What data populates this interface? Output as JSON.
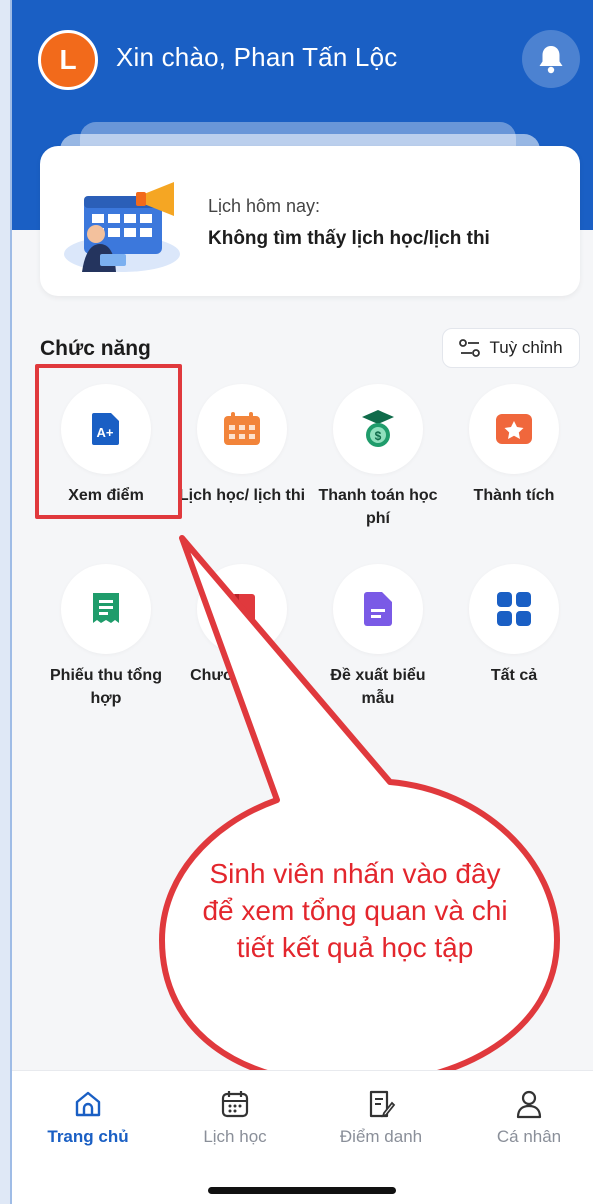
{
  "header": {
    "avatar_letter": "L",
    "greeting": "Xin chào, Phan Tấn Lộc",
    "bell_icon": "bell-icon"
  },
  "schedule": {
    "label": "Lịch hôm nay:",
    "value": "Không tìm thấy lịch học/lịch thi"
  },
  "functions": {
    "title": "Chức năng",
    "customize_label": "Tuỳ chỉnh",
    "items": [
      {
        "label": "Xem điểm",
        "icon": "grade-a-plus-icon",
        "color": "#1a5fc4"
      },
      {
        "label": "Lịch học/ lịch thi",
        "icon": "calendar-grid-icon",
        "color": "#f2843a"
      },
      {
        "label": "Thanh toán học phí",
        "icon": "tuition-coin-icon",
        "color": "#1f9c6b"
      },
      {
        "label": "Thành tích",
        "icon": "achievement-star-icon",
        "color": "#f0673c"
      },
      {
        "label": "Phiếu thu tổng hợp",
        "icon": "receipt-icon",
        "color": "#1f9c6b"
      },
      {
        "label": "Chươ... khu...",
        "icon": "program-book-icon",
        "color": "#e0393d"
      },
      {
        "label": "Đề xuất biểu mẫu",
        "icon": "form-document-icon",
        "color": "#7a5ae6"
      },
      {
        "label": "Tất cả",
        "icon": "all-apps-icon",
        "color": "#1a5fc4"
      }
    ]
  },
  "callout": {
    "text": "Sinh viên nhấn vào đây để xem tổng quan và chi tiết kết quả học tập",
    "color": "#e0393d"
  },
  "bottom_nav": {
    "items": [
      {
        "label": "Trang chủ",
        "icon": "home-icon",
        "active": true
      },
      {
        "label": "Lịch học",
        "icon": "calendar-icon",
        "active": false
      },
      {
        "label": "Điểm danh",
        "icon": "attendance-icon",
        "active": false
      },
      {
        "label": "Cá nhân",
        "icon": "user-icon",
        "active": false
      }
    ]
  },
  "colors": {
    "primary": "#1a5fc4",
    "accent": "#f26a1b",
    "annotation": "#e0393d"
  }
}
